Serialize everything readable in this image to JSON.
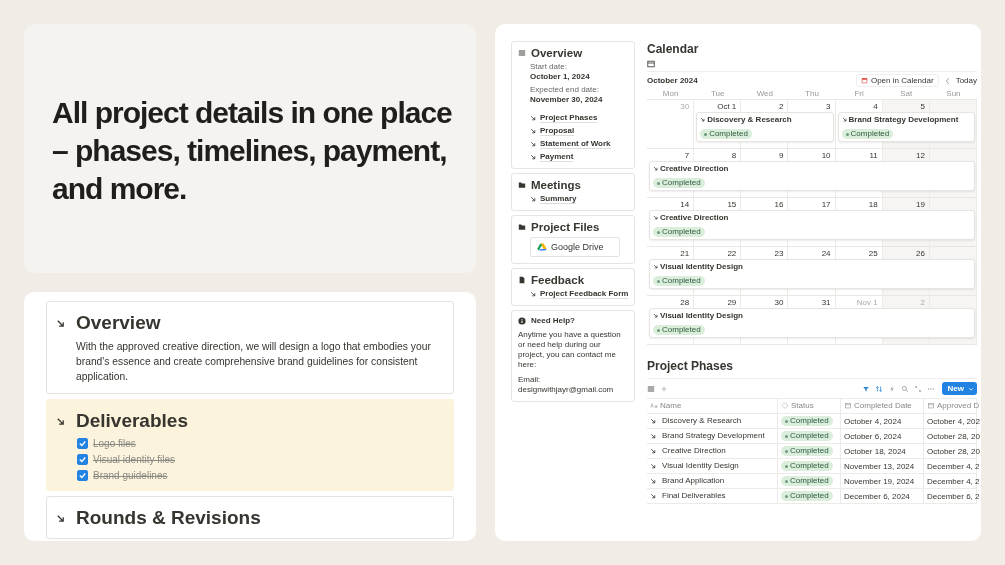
{
  "headline": "All project details in one place – phases, timelines, payment, and more.",
  "doc": {
    "sections": [
      {
        "kind": "paragraph",
        "title": "Overview",
        "highlighted": false,
        "text": "With the approved creative direction, we will design a logo that embodies your brand's essence and create comprehensive brand guidelines for consistent application."
      },
      {
        "kind": "checklist",
        "title": "Deliverables",
        "highlighted": true,
        "items": [
          {
            "label": "Logo files",
            "checked": true
          },
          {
            "label": "Visual identity files",
            "checked": true
          },
          {
            "label": "Brand guidelines",
            "checked": true
          }
        ]
      },
      {
        "kind": "heading",
        "title": "Rounds & Revisions",
        "highlighted": false
      }
    ]
  },
  "sidebar": [
    {
      "kind": "overview",
      "title": "Overview",
      "fields": [
        {
          "label": "Start date:",
          "value": "October 1, 2024"
        },
        {
          "label": "Expected end date:",
          "value": "November 30, 2024"
        }
      ],
      "links": [
        "Project Phases",
        "Proposal",
        "Statement of Work",
        "Payment"
      ]
    },
    {
      "kind": "folder",
      "title": "Meetings",
      "links": [
        "Summary"
      ]
    },
    {
      "kind": "files",
      "title": "Project Files",
      "button": "Google Drive"
    },
    {
      "kind": "page",
      "title": "Feedback",
      "links": [
        "Project Feedback Form"
      ]
    },
    {
      "kind": "help",
      "title": "Need Help?",
      "text": "Anytime you have a question or need help during our project, you can contact me here:",
      "email_label": "Email:",
      "email": "designwithjayr@gmail.com"
    }
  ],
  "calendar": {
    "title": "Calendar",
    "month": "October 2024",
    "open_button": "Open in Calendar",
    "today_button": "Today",
    "weekdays": [
      "Mon",
      "Tue",
      "Wed",
      "Thu",
      "Fri",
      "Sat",
      "Sun"
    ],
    "weeks": [
      {
        "days": [
          {
            "label": "30",
            "muted": true
          },
          {
            "label": "Oct 1",
            "muted": false,
            "event": {
              "title": "Discovery & Research",
              "status": "Completed"
            }
          },
          {
            "label": "2",
            "muted": false
          },
          {
            "label": "3",
            "muted": false
          },
          {
            "label": "4",
            "muted": false,
            "event": {
              "title": "Brand Strategy Development",
              "status": "Completed"
            }
          },
          {
            "label": "5",
            "muted": false
          }
        ]
      },
      {
        "days": [
          {
            "label": "7",
            "muted": false,
            "event": {
              "title": "Creative Direction",
              "status": "Completed"
            }
          },
          {
            "label": "8",
            "muted": false
          },
          {
            "label": "9",
            "muted": false
          },
          {
            "label": "10",
            "muted": false
          },
          {
            "label": "11",
            "muted": false
          },
          {
            "label": "12",
            "muted": false
          }
        ]
      },
      {
        "days": [
          {
            "label": "14",
            "muted": false,
            "event": {
              "title": "Creative Direction",
              "status": "Completed"
            }
          },
          {
            "label": "15",
            "muted": false
          },
          {
            "label": "16",
            "muted": false
          },
          {
            "label": "17",
            "muted": false
          },
          {
            "label": "18",
            "muted": false
          },
          {
            "label": "19",
            "muted": false
          }
        ]
      },
      {
        "days": [
          {
            "label": "21",
            "muted": false,
            "event": {
              "title": "Visual Identity Design",
              "status": "Completed"
            }
          },
          {
            "label": "22",
            "muted": false
          },
          {
            "label": "23",
            "muted": false
          },
          {
            "label": "24",
            "muted": false
          },
          {
            "label": "25",
            "muted": false
          },
          {
            "label": "26",
            "muted": false
          }
        ]
      },
      {
        "days": [
          {
            "label": "28",
            "muted": false,
            "event": {
              "title": "Visual Identity Design",
              "status": "Completed"
            }
          },
          {
            "label": "29",
            "muted": false
          },
          {
            "label": "30",
            "muted": false
          },
          {
            "label": "31",
            "muted": false
          },
          {
            "label": "Nov 1",
            "muted": true
          },
          {
            "label": "2",
            "muted": true
          }
        ]
      }
    ]
  },
  "phases": {
    "title": "Project Phases",
    "new_button": "New",
    "columns": [
      "Name",
      "Status",
      "Completed Date",
      "Approved D"
    ],
    "rows": [
      {
        "name": "Discovery & Research",
        "status": "Completed",
        "completed": "October 4, 2024",
        "approved": "October 4, 202"
      },
      {
        "name": "Brand Strategy Development",
        "status": "Completed",
        "completed": "October 6, 2024",
        "approved": "October 28, 20"
      },
      {
        "name": "Creative Direction",
        "status": "Completed",
        "completed": "October 18, 2024",
        "approved": "October 28, 20"
      },
      {
        "name": "Visual Identity Design",
        "status": "Completed",
        "completed": "November 13, 2024",
        "approved": "December 4, 2"
      },
      {
        "name": "Brand Application",
        "status": "Completed",
        "completed": "November 19, 2024",
        "approved": "December 4, 2"
      },
      {
        "name": "Final Deliverables",
        "status": "Completed",
        "completed": "December 6, 2024",
        "approved": "December 6, 2"
      }
    ]
  }
}
